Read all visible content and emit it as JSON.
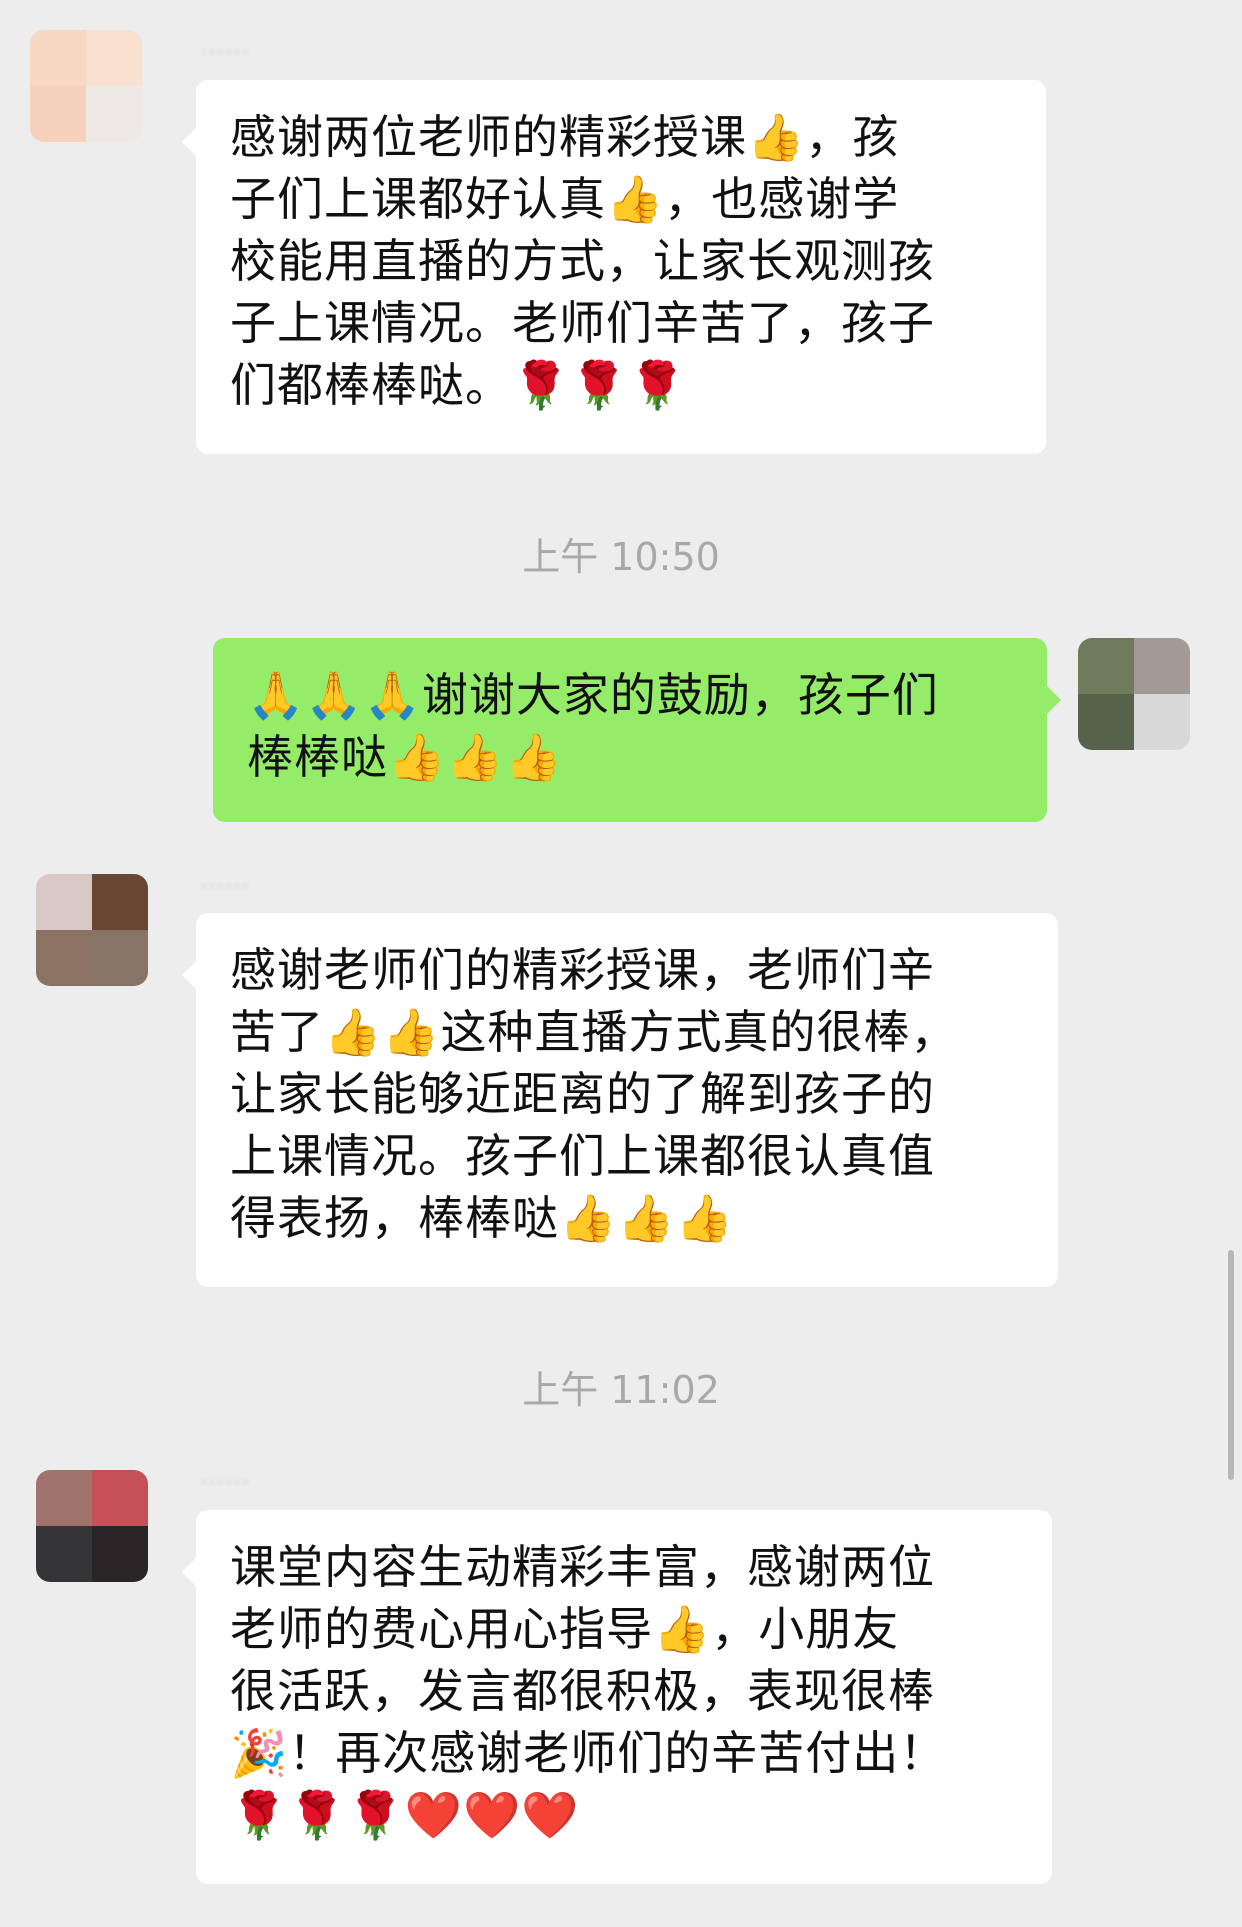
{
  "messages": [
    {
      "side": "left",
      "sender_name": "······",
      "lines": [
        "感谢两位老师的精彩授课👍，孩",
        "子们上课都好认真👍，也感谢学",
        "校能用直播的方式，让家长观测孩",
        "子上课情况。老师们辛苦了，孩子",
        "们都棒棒哒。🌹🌹🌹"
      ]
    },
    {
      "side": "right",
      "lines": [
        "🙏🙏🙏谢谢大家的鼓励，孩子们",
        "棒棒哒👍👍👍"
      ]
    },
    {
      "side": "left",
      "sender_name": "······",
      "lines": [
        "感谢老师们的精彩授课，老师们辛",
        "苦了👍👍这种直播方式真的很棒，",
        "让家长能够近距离的了解到孩子的",
        "上课情况。孩子们上课都很认真值",
        "得表扬，棒棒哒👍👍👍"
      ]
    },
    {
      "side": "left",
      "sender_name": "······",
      "lines": [
        "课堂内容生动精彩丰富，感谢两位",
        "老师的费心用心指导👍，小朋友",
        "很活跃，发言都很积极，表现很棒",
        "🎉！再次感谢老师们的辛苦付出！",
        "🌹🌹🌹❤️❤️❤️"
      ]
    }
  ],
  "timestamps": [
    "上午 10:50",
    "上午 11:02"
  ],
  "colors": {
    "background": "#EDEDED",
    "incoming_bubble": "#FFFFFF",
    "outgoing_bubble": "#95EC69",
    "timestamp_text": "#A8A8A8"
  }
}
